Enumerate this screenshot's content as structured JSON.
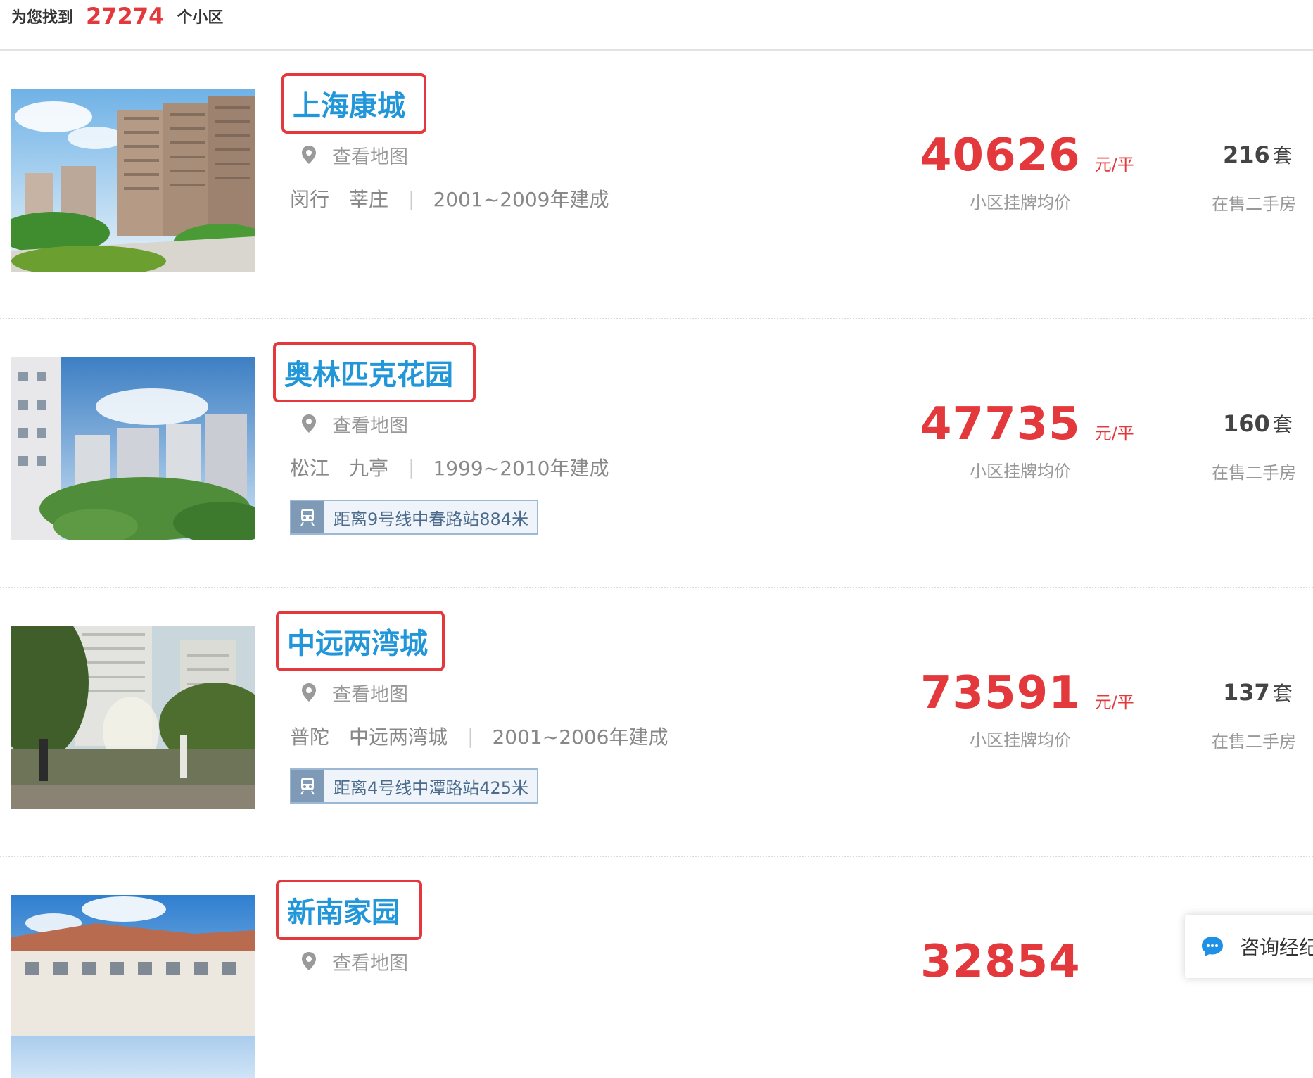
{
  "summary": {
    "prefix": "为您找到",
    "count": "27274",
    "suffix": "个小区"
  },
  "listings": [
    {
      "name": "上海康城",
      "map_link": "查看地图",
      "district": "闵行",
      "area": "莘庄",
      "sep": "|",
      "built": "2001~2009年建成",
      "subway": "",
      "price": "40626",
      "price_unit": "元/平",
      "price_label": "小区挂牌均价",
      "stock": "216",
      "stock_unit": "套",
      "stock_label": "在售二手房"
    },
    {
      "name": "奥林匹克花园",
      "map_link": "查看地图",
      "district": "松江",
      "area": "九亭",
      "sep": "|",
      "built": "1999~2010年建成",
      "subway": "距离9号线中春路站884米",
      "price": "47735",
      "price_unit": "元/平",
      "price_label": "小区挂牌均价",
      "stock": "160",
      "stock_unit": "套",
      "stock_label": "在售二手房"
    },
    {
      "name": "中远两湾城",
      "map_link": "查看地图",
      "district": "普陀",
      "area": "中远两湾城",
      "sep": "|",
      "built": "2001~2006年建成",
      "subway": "距离4号线中潭路站425米",
      "price": "73591",
      "price_unit": "元/平",
      "price_label": "小区挂牌均价",
      "stock": "137",
      "stock_unit": "套",
      "stock_label": "在售二手房"
    },
    {
      "name": "新南家园",
      "map_link": "查看地图",
      "price": "32854"
    }
  ],
  "chat": {
    "label": "咨询经纪人"
  },
  "colors": {
    "accent": "#e4393c",
    "link": "#2196d9",
    "subway_bg": "#eef4fa",
    "subway_icon": "#7f9ab7"
  },
  "icons": {
    "map": "location-pin-icon",
    "subway": "subway-train-icon",
    "chat": "chat-bubble-icon"
  }
}
